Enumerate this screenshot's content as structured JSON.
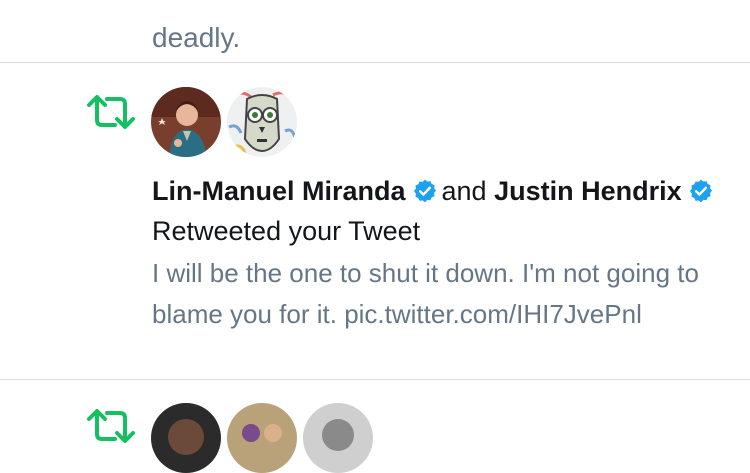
{
  "previous_tweet": {
    "partial_text": "deadly."
  },
  "notification": {
    "type": "retweet",
    "actor_1": "Lin-Manuel Miranda",
    "connector": "and",
    "actor_2": "Justin Hendrix",
    "action_text": "Retweeted your Tweet",
    "tweet_text": "I will be the one to shut it down. I'm not going to blame you for it. pic.twitter.com/IHI7JvePnl"
  },
  "colors": {
    "retweet_green": "#17bf63",
    "verified_blue": "#1da1f2",
    "muted_text": "#657786",
    "divider": "#d9dde1"
  },
  "icons": {
    "retweet": "retweet-icon",
    "verified": "verified-badge-icon"
  }
}
